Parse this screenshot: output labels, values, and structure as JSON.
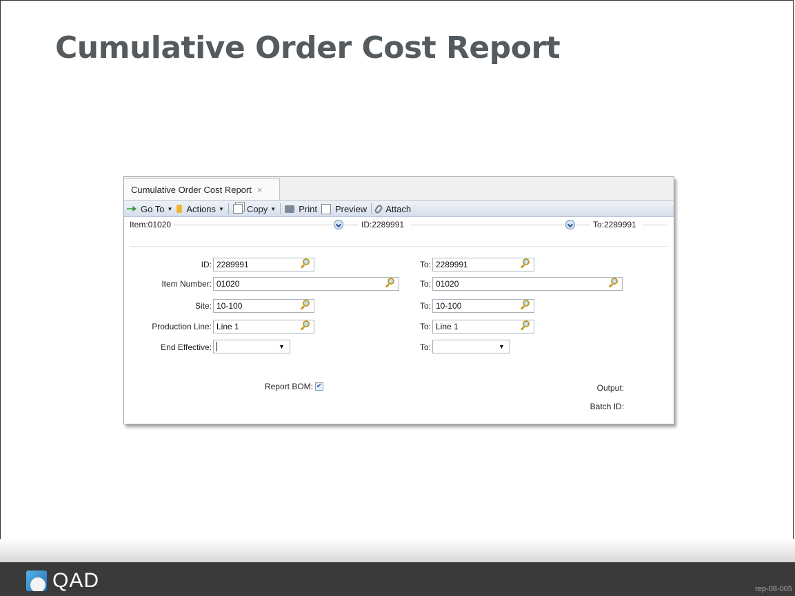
{
  "slide": {
    "title": "Cumulative Order Cost Report",
    "footer_logo_text": "QAD",
    "slide_code": "rep-08-005"
  },
  "window": {
    "tab_title": "Cumulative Order Cost Report",
    "tab_close_glyph": "×",
    "toolbar": {
      "goto": "Go To",
      "actions": "Actions",
      "copy": "Copy",
      "print": "Print",
      "preview": "Preview",
      "attach": "Attach"
    },
    "summary": {
      "item": "Item:01020",
      "id": "ID:2289991",
      "to": "To:2289991"
    },
    "form": {
      "id_label": "ID:",
      "id_value": "2289991",
      "id_to_label": "To:",
      "id_to_value": "2289991",
      "item_label": "Item Number:",
      "item_value": "01020",
      "item_to_label": "To:",
      "item_to_value": "01020",
      "site_label": "Site:",
      "site_value": "10-100",
      "site_to_label": "To:",
      "site_to_value": "10-100",
      "line_label": "Production Line:",
      "line_value": "Line 1",
      "line_to_label": "To:",
      "line_to_value": "Line 1",
      "end_eff_label": "End Effective:",
      "end_eff_value": "",
      "end_eff_to_label": "To:",
      "end_eff_to_value": "",
      "report_bom_label": "Report BOM:",
      "report_bom_checked": true,
      "output_label": "Output:",
      "batch_label": "Batch ID:"
    }
  }
}
